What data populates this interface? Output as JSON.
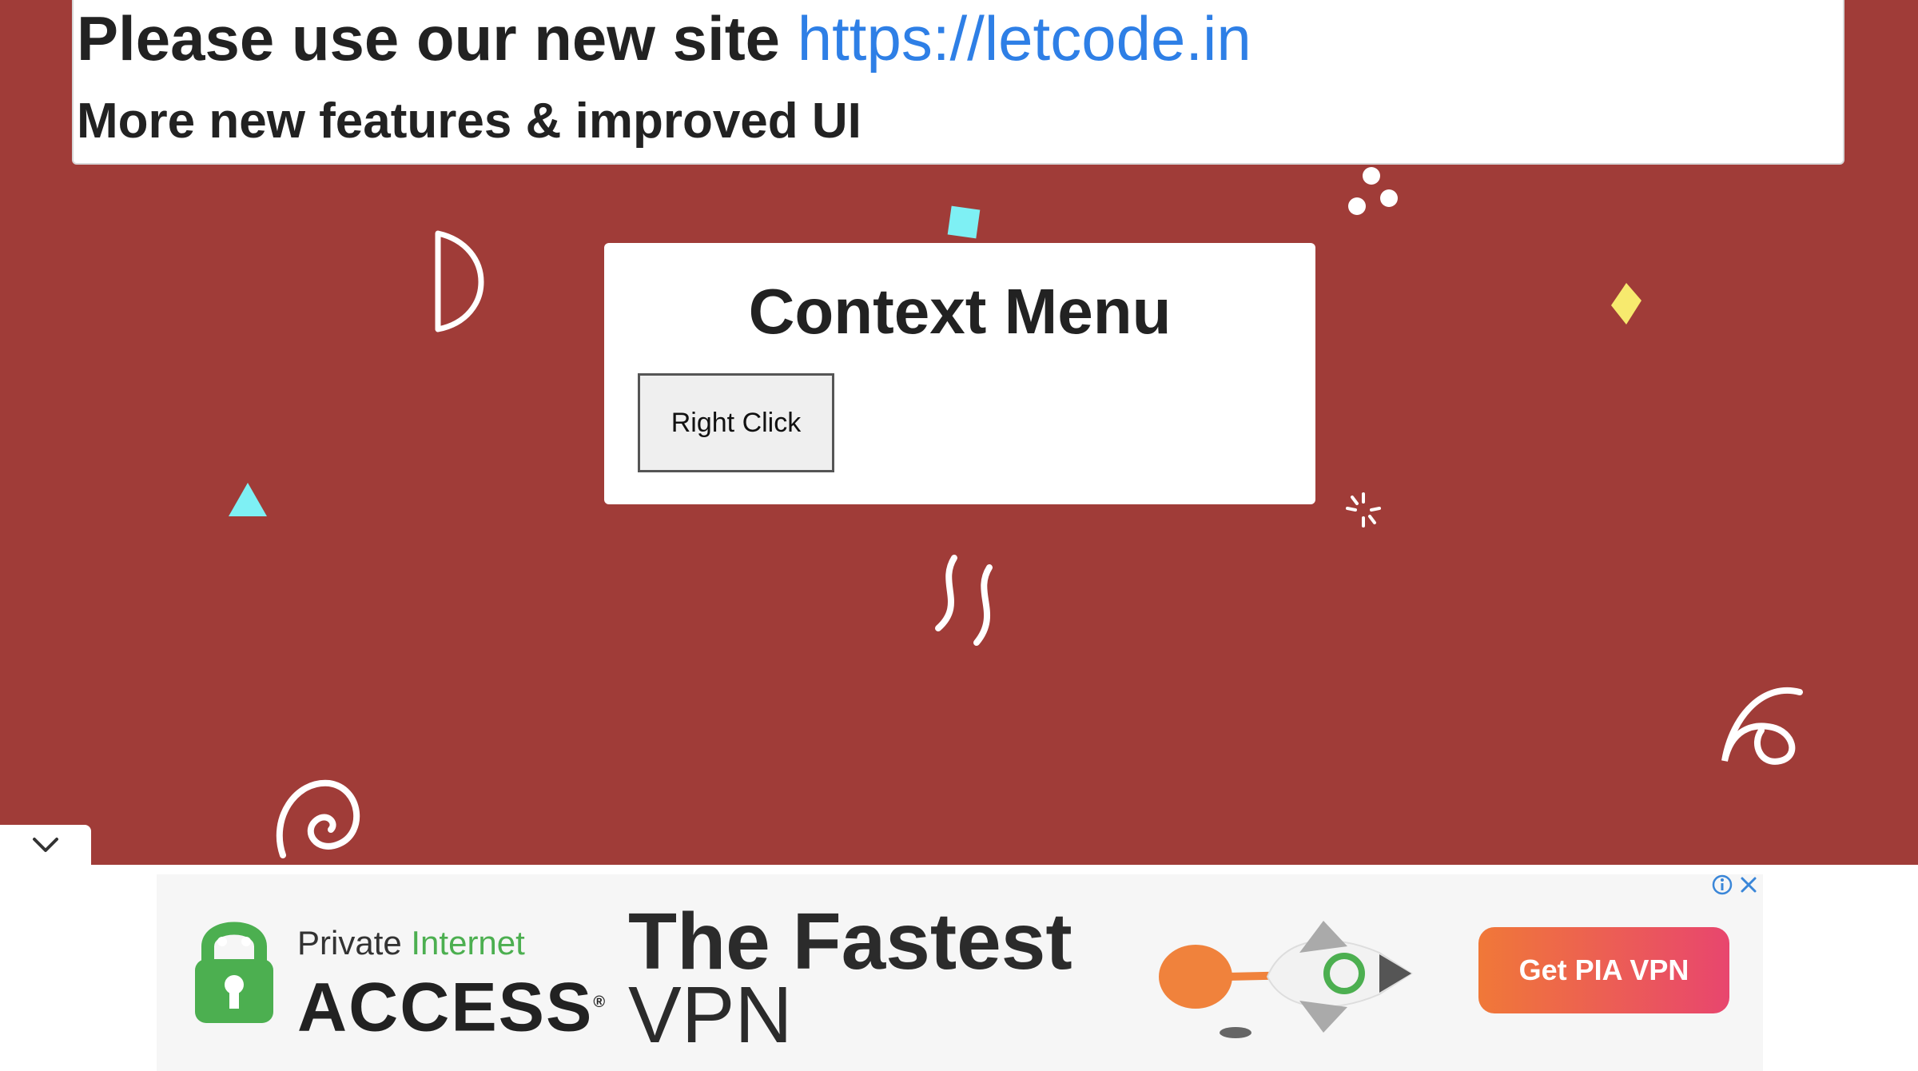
{
  "banner": {
    "prefix": "Please use our new site ",
    "link": "https://letcode.in",
    "subtitle": "More new features & improved UI"
  },
  "card": {
    "title": "Context Menu",
    "button_label": "Right Click"
  },
  "ad": {
    "brand_sub_prefix": "Private ",
    "brand_sub_green": "Internet",
    "brand_main": "ACCESS",
    "brand_registered": "®",
    "headline_bold": "The Fastest",
    "headline_light": "VPN",
    "cta_label": "Get PIA VPN"
  },
  "icons": {
    "collapse": "chevron-down-icon",
    "ad_info": "info-icon",
    "ad_close": "close-icon"
  },
  "colors": {
    "background": "#a03c38",
    "link": "#2e7fe6",
    "cta_start": "#f07838",
    "cta_end": "#e8466e",
    "brand_green": "#4caf50"
  }
}
